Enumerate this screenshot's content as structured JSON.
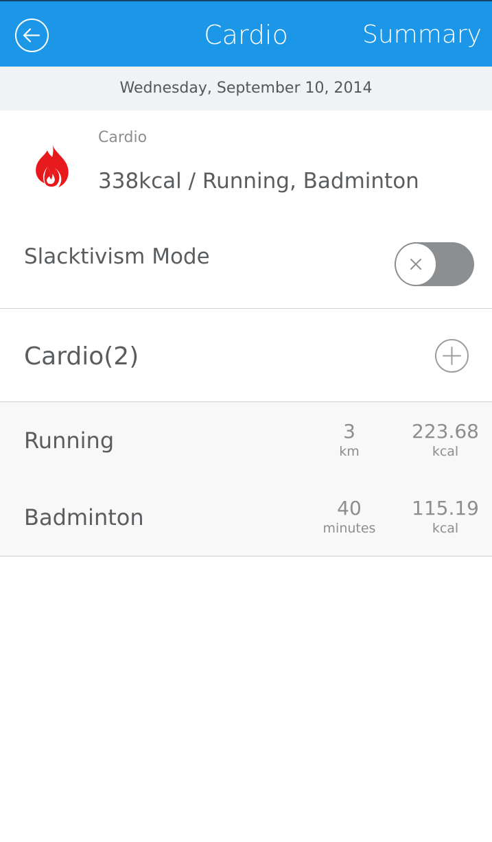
{
  "header": {
    "title": "Cardio",
    "summary_label": "Summary",
    "brand_color": "#1c97e8",
    "back_icon": "arrow-left-circle-icon"
  },
  "date": "Wednesday, September 10, 2014",
  "cardio_summary": {
    "icon": "flame-icon",
    "icon_color": "#e8191c",
    "label": "Cardio",
    "value": "338kcal / Running, Badminton"
  },
  "slacktivism": {
    "label": "Slacktivism Mode",
    "enabled": false,
    "toggle_icon": "close-icon"
  },
  "cardio_list": {
    "title": "Cardio(2)",
    "add_icon": "plus-circle-icon",
    "items": [
      {
        "name": "Running",
        "amount": "3",
        "amount_unit": "km",
        "calories": "223.68",
        "calories_unit": "kcal"
      },
      {
        "name": "Badminton",
        "amount": "40",
        "amount_unit": "minutes",
        "calories": "115.19",
        "calories_unit": "kcal"
      }
    ]
  }
}
